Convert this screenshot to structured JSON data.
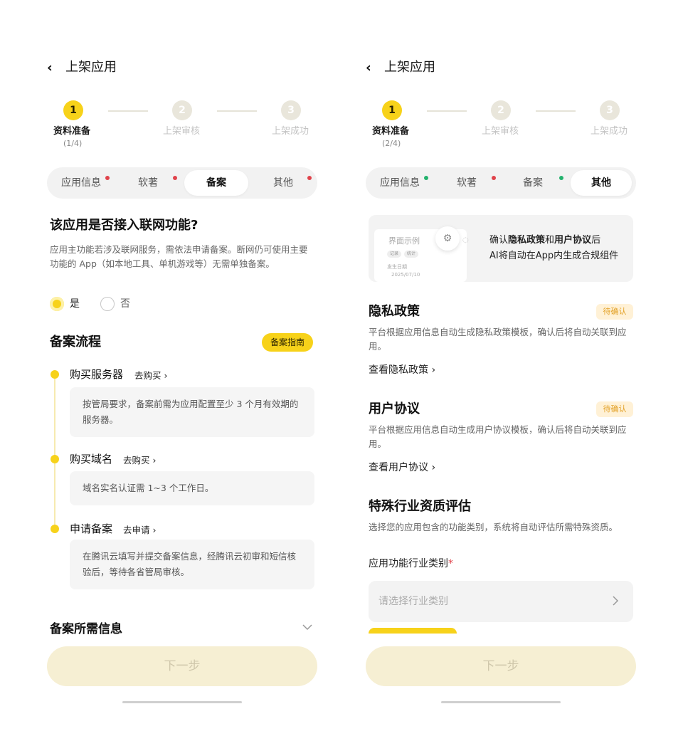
{
  "header": {
    "back_glyph": "‹",
    "title": "上架应用"
  },
  "steps": [
    {
      "num": "1",
      "label": "资料准备"
    },
    {
      "num": "2",
      "label": "上架审核"
    },
    {
      "num": "3",
      "label": "上架成功"
    }
  ],
  "left": {
    "progress": "(1/4)",
    "tabs": [
      "应用信息",
      "软著",
      "备案",
      "其他"
    ],
    "question": "该应用是否接入联网功能?",
    "question_desc": "应用主功能若涉及联网服务，需依法申请备案。断网仍可使用主要功能的 App（如本地工具、单机游戏等）无需单独备案。",
    "options": {
      "yes": "是",
      "no": "否"
    },
    "flow_title": "备案流程",
    "guide_button": "备案指南",
    "flow": [
      {
        "title": "购买服务器",
        "link": "去购买 ›",
        "detail": "按管局要求，备案前需为应用配置至少 3 个月有效期的服务器。"
      },
      {
        "title": "购买域名",
        "link": "去购买 ›",
        "detail": "域名实名认证需 1~3 个工作日。"
      },
      {
        "title": "申请备案",
        "link": "去申请 ›",
        "detail": "在腾讯云填写并提交备案信息，经腾讯云初审和短信核验后，等待各省管局审核。"
      }
    ],
    "info_title": "备案所需信息",
    "next": "下一步"
  },
  "right": {
    "progress": "(2/4)",
    "tabs": [
      "应用信息",
      "软著",
      "备案",
      "其他"
    ],
    "banner": {
      "preview_title": "界面示例",
      "chip1": "记录",
      "chip2": "统计",
      "mini_label": "发生日期",
      "mini_date": "2025/07/10",
      "line1_pre": "确认",
      "line1_b1": "隐私政策",
      "line1_mid": "和",
      "line1_b2": "用户协议",
      "line1_post": "后",
      "line2": "AI将自动在App内生成合规组件"
    },
    "privacy": {
      "title": "隐私政策",
      "badge": "待确认",
      "desc": "平台根据应用信息自动生成隐私政策模板，确认后将自动关联到应用。",
      "link": "查看隐私政策 ›"
    },
    "agreement": {
      "title": "用户协议",
      "badge": "待确认",
      "desc": "平台根据应用信息自动生成用户协议模板，确认后将自动关联到应用。",
      "link": "查看用户协议 ›"
    },
    "industry": {
      "title": "特殊行业资质评估",
      "desc": "选择您的应用包含的功能类别，系统将自动评估所需特殊资质。",
      "field_label": "应用功能行业类别",
      "required": "*",
      "placeholder": "请选择行业类别"
    },
    "next": "下一步"
  },
  "colors": {
    "accent": "#f7d21a",
    "dot_red": "#e0434b",
    "dot_green": "#23b26d",
    "badge_text": "#e3a229"
  }
}
